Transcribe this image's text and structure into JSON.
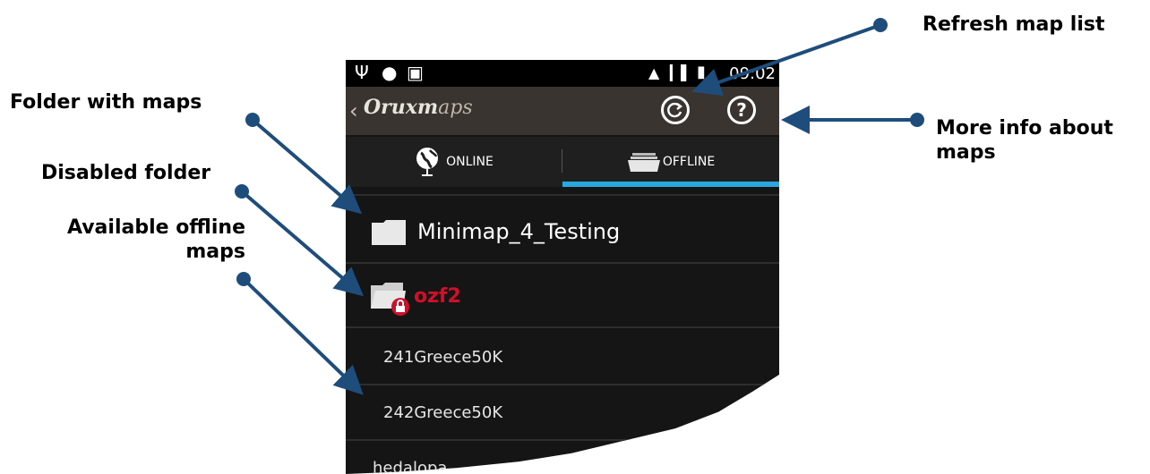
{
  "callouts": {
    "refresh": "Refresh map list",
    "folder_with_maps": "Folder with maps",
    "disabled_folder": "Disabled folder",
    "available_offline_line1": "Available offline",
    "available_offline_line2": "maps",
    "more_info_line1": "More info about",
    "more_info_line2": "maps"
  },
  "status_bar": {
    "time": "09:02"
  },
  "app": {
    "logo_bold": "Oruxm",
    "logo_light": "aps",
    "back_icon": "chevron-left-icon",
    "refresh_icon": "refresh-icon",
    "help_icon": "help-icon"
  },
  "tabs": [
    {
      "label": "ONLINE",
      "icon": "globe-icon",
      "selected": false
    },
    {
      "label": "OFFLINE",
      "icon": "map-stack-icon",
      "selected": true
    }
  ],
  "list": {
    "folders": [
      {
        "name": "Minimap_4_Testing",
        "icon": "folder-icon",
        "disabled": false
      },
      {
        "name": "ozf2",
        "icon": "locked-folder-icon",
        "disabled": true
      }
    ],
    "maps": [
      "241Greece50K",
      "242Greece50K",
      "hedalopa"
    ]
  },
  "colors": {
    "arrow": "#1e4d7b",
    "accent_tab": "#29a8e0",
    "disabled_text": "#d0102a",
    "actionbar": "#3a3430"
  }
}
